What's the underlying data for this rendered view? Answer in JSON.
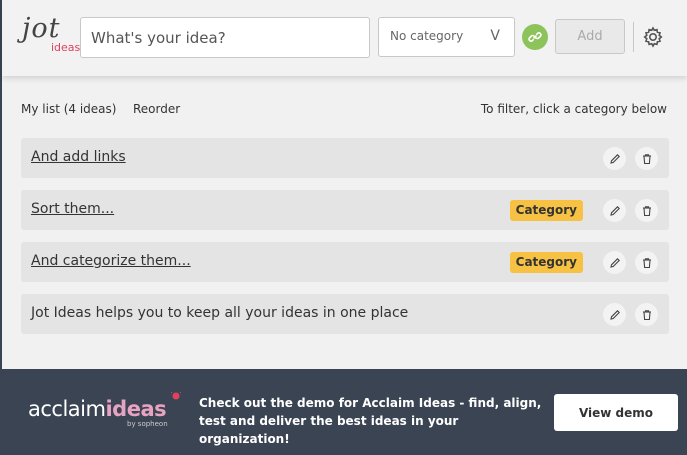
{
  "header": {
    "logo_top": "jot",
    "logo_bottom": "ideas",
    "idea_placeholder": "What's your idea?",
    "category_selected": "No category",
    "category_chevron": "V",
    "add_label": "Add",
    "link_icon": "link-icon",
    "settings_icon": "gear-icon"
  },
  "list": {
    "title": "My list (4 ideas)",
    "reorder_label": "Reorder",
    "filter_hint": "To filter, click a category below",
    "items": [
      {
        "text": "And add links",
        "link": true,
        "category": ""
      },
      {
        "text": "Sort them...",
        "link": true,
        "category": "Category"
      },
      {
        "text": "And categorize them...",
        "link": true,
        "category": "Category"
      },
      {
        "text": "Jot Ideas helps you to keep all your ideas in one place",
        "link": false,
        "category": ""
      }
    ]
  },
  "banner": {
    "brand_main": "acclaim",
    "brand_accent": "ideas",
    "brand_sub": "by sopheon",
    "message": "Check out the demo for Acclaim Ideas - find, align, test and deliver the best ideas in your organization!",
    "button_label": "View demo"
  },
  "colors": {
    "banner_bg": "#3b4453",
    "category_badge": "#f7c244",
    "link_green": "#8cc35a",
    "logo_accent": "#e0415e"
  }
}
